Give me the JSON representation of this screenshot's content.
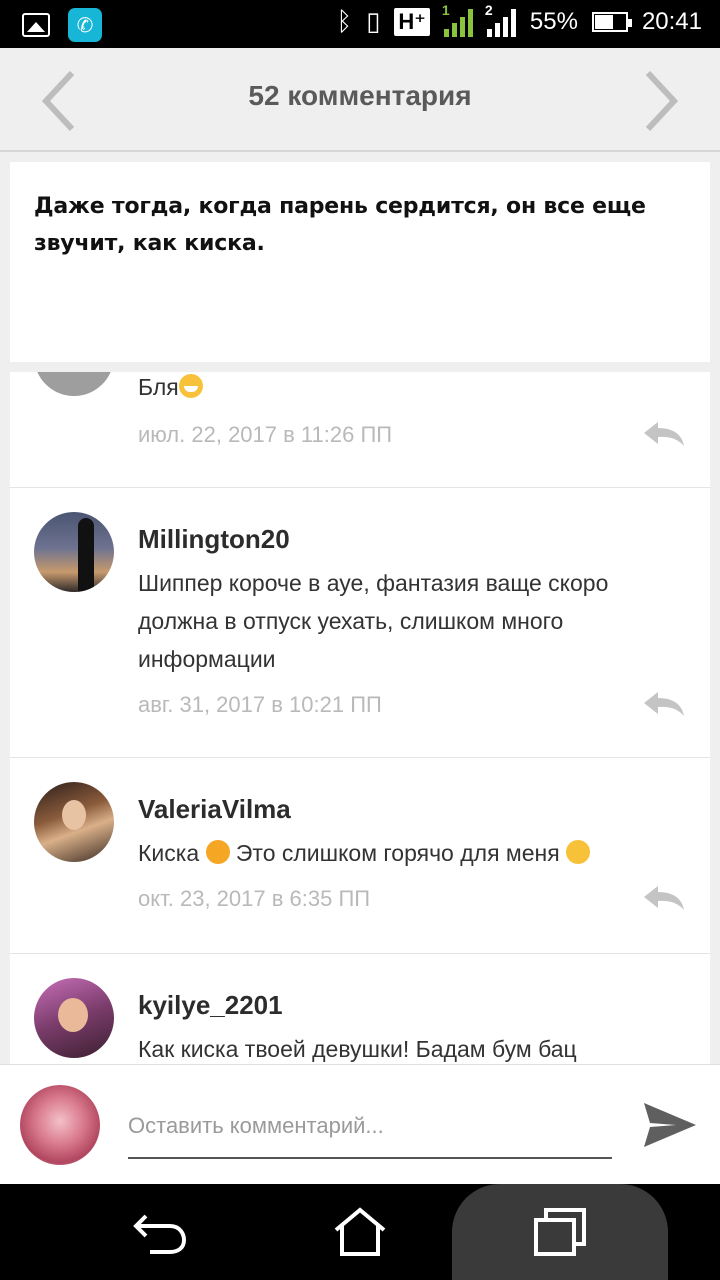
{
  "status_bar": {
    "battery": "55%",
    "time": "20:41",
    "network_type": "H",
    "sim1": "1",
    "sim2": "2"
  },
  "header": {
    "title": "52 комментария"
  },
  "post": {
    "text": "Даже тогда, когда парень сердится, он все еще звучит, как киска."
  },
  "comments": [
    {
      "author": "",
      "text": "Бля",
      "date": "июл. 22, 2017 в 11:26 ПП"
    },
    {
      "author": "Millington20",
      "text": "Шиппер короче в ауе, фантазия ваще скоро должна в отпуск уехать, слишком много информации",
      "date": "авг. 31, 2017 в 10:21 ПП"
    },
    {
      "author": "ValeriaVilma",
      "text_part1": "Киска",
      "text_part2": "Это слишком горячо для меня",
      "date": "окт. 23, 2017 в 6:35 ПП"
    },
    {
      "author": "kyilye_2201",
      "text": "Как киска твоей девушки! Бадам бум бац"
    }
  ],
  "composer": {
    "placeholder": "Оставить комментарий..."
  },
  "colors": {
    "accent_status": "#8ac43f",
    "app_icon": "#17b6d6",
    "date_text": "#b9b9b9"
  }
}
